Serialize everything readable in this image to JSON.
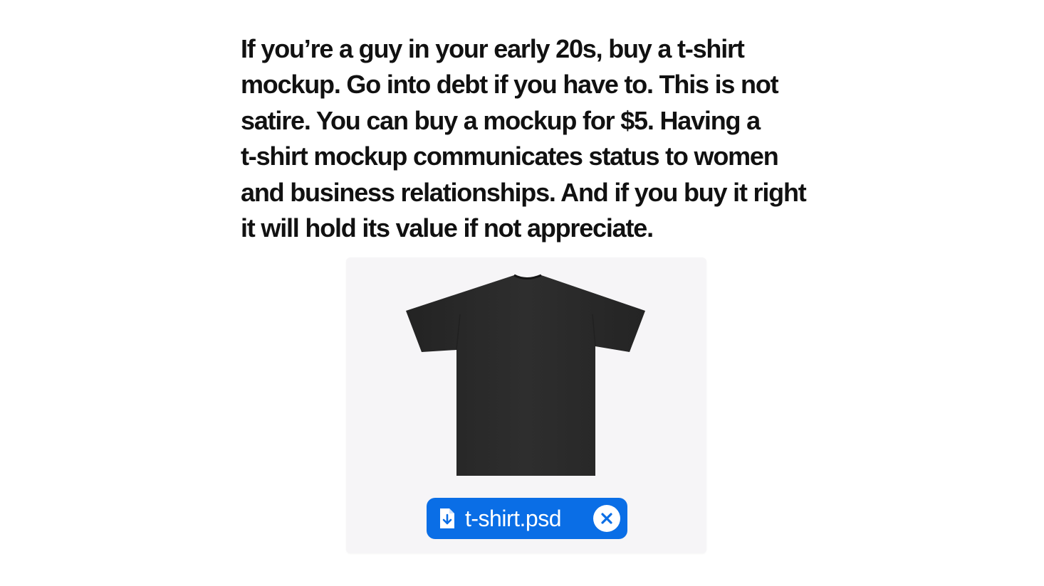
{
  "post": {
    "lines": [
      "If you’re a guy in your early 20s, buy a t-shirt",
      "mockup. Go into debt if you have to. This is not",
      "satire. You can buy a mockup for $5. Having a",
      "t-shirt mockup communicates status to women",
      "and business relationships. And if you buy it right",
      "it will hold its value if not appreciate."
    ]
  },
  "attachment": {
    "image_icon": "black-tshirt-image",
    "file_icon": "file-download-icon",
    "file_name": "t-shirt.psd",
    "remove_icon": "close-circle-icon",
    "chip_color": "#0a6ee6"
  }
}
